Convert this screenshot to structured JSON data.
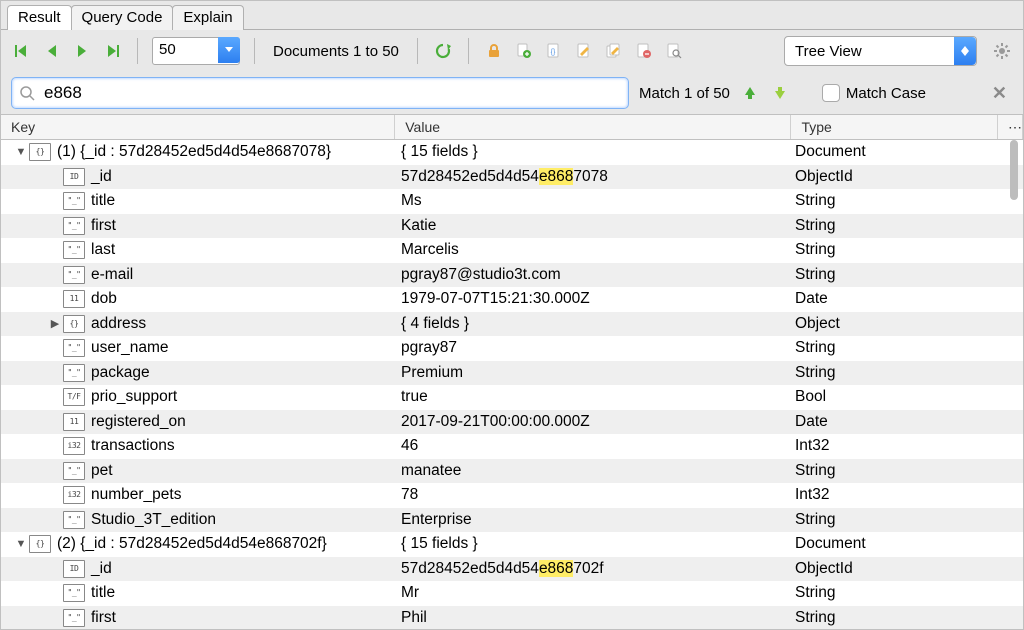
{
  "tabs": [
    "Result",
    "Query Code",
    "Explain"
  ],
  "activeTab": 0,
  "toolbar": {
    "page_size": "50",
    "doc_range": "Documents 1 to 50",
    "view_mode": "Tree View"
  },
  "search": {
    "value": "e868",
    "match_label": "Match 1 of 50",
    "match_case": "Match Case"
  },
  "headers": {
    "key": "Key",
    "value": "Value",
    "type": "Type"
  },
  "rows": [
    {
      "depth": 0,
      "icon": "{}",
      "twisty": "down",
      "key": "(1) {_id : 57d28452ed5d4d54e8687078}",
      "value": "{ 15 fields }",
      "type": "Document",
      "alt": false
    },
    {
      "depth": 1,
      "icon": "ID",
      "key": "_id",
      "value": [
        "57d28452ed5d4d54",
        "e868",
        "7078"
      ],
      "hl": true,
      "type": "ObjectId",
      "alt": true
    },
    {
      "depth": 1,
      "icon": "\"_\"",
      "key": "title",
      "value": "Ms",
      "type": "String",
      "alt": false
    },
    {
      "depth": 1,
      "icon": "\"_\"",
      "key": "first",
      "value": "Katie",
      "type": "String",
      "alt": true
    },
    {
      "depth": 1,
      "icon": "\"_\"",
      "key": "last",
      "value": "Marcelis",
      "type": "String",
      "alt": false
    },
    {
      "depth": 1,
      "icon": "\"_\"",
      "key": "e-mail",
      "value": "pgray87@studio3t.com",
      "type": "String",
      "alt": true
    },
    {
      "depth": 1,
      "icon": "11",
      "key": "dob",
      "value": "1979-07-07T15:21:30.000Z",
      "type": "Date",
      "alt": false
    },
    {
      "depth": 1,
      "icon": "{}",
      "twisty": "right",
      "key": "address",
      "value": "{ 4 fields }",
      "type": "Object",
      "alt": true
    },
    {
      "depth": 1,
      "icon": "\"_\"",
      "key": "user_name",
      "value": "pgray87",
      "type": "String",
      "alt": false
    },
    {
      "depth": 1,
      "icon": "\"_\"",
      "key": "package",
      "value": "Premium",
      "type": "String",
      "alt": true
    },
    {
      "depth": 1,
      "icon": "T/F",
      "key": "prio_support",
      "value": "true",
      "type": "Bool",
      "alt": false
    },
    {
      "depth": 1,
      "icon": "11",
      "key": "registered_on",
      "value": "2017-09-21T00:00:00.000Z",
      "type": "Date",
      "alt": true
    },
    {
      "depth": 1,
      "icon": "i32",
      "key": "transactions",
      "value": "46",
      "type": "Int32",
      "alt": false
    },
    {
      "depth": 1,
      "icon": "\"_\"",
      "key": "pet",
      "value": "manatee",
      "type": "String",
      "alt": true
    },
    {
      "depth": 1,
      "icon": "i32",
      "key": "number_pets",
      "value": "78",
      "type": "Int32",
      "alt": false
    },
    {
      "depth": 1,
      "icon": "\"_\"",
      "key": "Studio_3T_edition",
      "value": "Enterprise",
      "type": "String",
      "alt": true
    },
    {
      "depth": 0,
      "icon": "{}",
      "twisty": "down",
      "key": "(2) {_id : 57d28452ed5d4d54e868702f}",
      "value": "{ 15 fields }",
      "type": "Document",
      "alt": false
    },
    {
      "depth": 1,
      "icon": "ID",
      "key": "_id",
      "value": [
        "57d28452ed5d4d54",
        "e868",
        "702f"
      ],
      "hl": true,
      "type": "ObjectId",
      "alt": true
    },
    {
      "depth": 1,
      "icon": "\"_\"",
      "key": "title",
      "value": "Mr",
      "type": "String",
      "alt": false
    },
    {
      "depth": 1,
      "icon": "\"_\"",
      "key": "first",
      "value": "Phil",
      "type": "String",
      "alt": true
    }
  ]
}
